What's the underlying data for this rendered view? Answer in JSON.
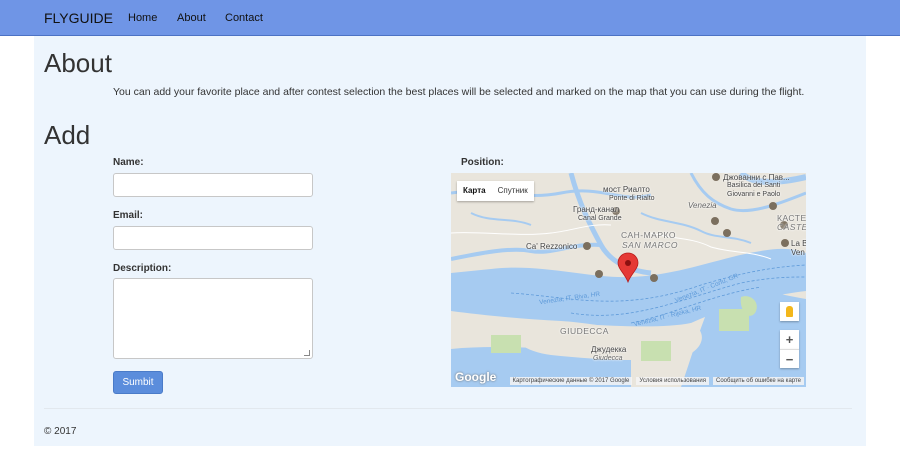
{
  "navbar": {
    "brand": "FLYGUIDE",
    "links": [
      "Home",
      "About",
      "Contact"
    ]
  },
  "about": {
    "heading": "About",
    "text": "You can add your favorite place and after contest selection the best places will be selected and marked on the map that you can use during the flight."
  },
  "add": {
    "heading": "Add",
    "name_label": "Name:",
    "name_value": "",
    "email_label": "Email:",
    "email_value": "",
    "description_label": "Description:",
    "description_value": "",
    "submit_label": "Sumbit",
    "position_label": "Position:"
  },
  "map": {
    "type_map": "Карта",
    "type_satellite": "Спутник",
    "zoom_in": "+",
    "zoom_out": "−",
    "places": {
      "ponte_rialto_1": "мост Риалто",
      "ponte_rialto_2": "Ponte di Rialto",
      "canal_grande_1": "Гранд-канал",
      "canal_grande_2": "Canal Grande",
      "venezia": "Venezia",
      "san_marco_1": "САН-МАРКО",
      "san_marco_2": "SAN MARCO",
      "ca_rezzonico": "Ca' Rezzonico",
      "giudecca_district": "GIUDECCA",
      "giudecca_1": "Джудекка",
      "giudecca_2": "Giudecca",
      "basilica_1": "Джованни с Пав...",
      "basilica_2": "Basilica dei Santi",
      "basilica_3": "Giovanni e Paolo",
      "castello_1": "КАСТЕ",
      "castello_2": "CASTE",
      "la_b_1": "La B",
      "la_b_2": "Ven",
      "canale_1": "Venezia, IT, Riva, HR",
      "canale_2": "Venezia, IT · Rijeka, HR",
      "canale_3": "Venezia, IT · Corfu, GR"
    },
    "footer": {
      "data": "Картографические данные © 2017 Google",
      "terms": "Условия использования",
      "report": "Сообщить об ошибке на карте"
    },
    "logo": "Google",
    "colors": {
      "water": "#a6cbf1",
      "land": "#e9e5dc",
      "park": "#c8e0b0",
      "marker": "#e53935"
    }
  },
  "footer": {
    "copyright": "© 2017"
  },
  "colors": {
    "navbar": "#6f95e6",
    "container": "#edf5fd",
    "button": "#5b8ddc"
  }
}
